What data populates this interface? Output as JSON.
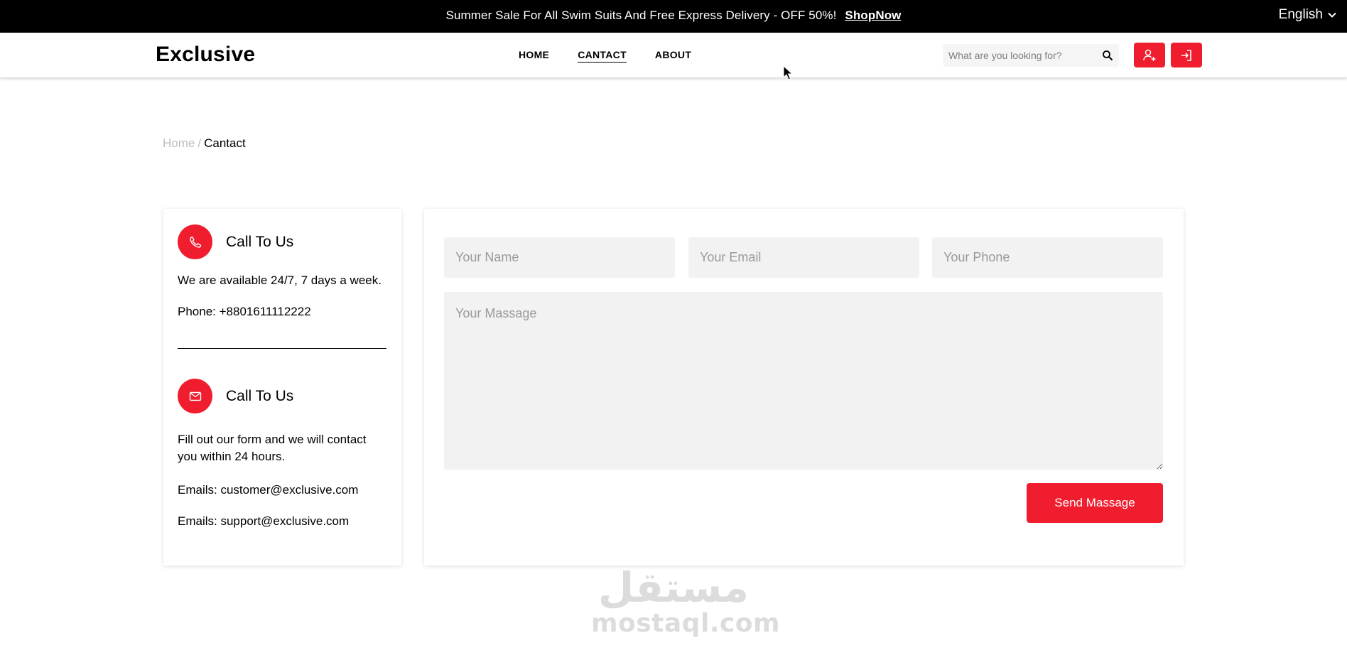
{
  "topbar": {
    "promo_text": "Summer Sale For All Swim Suits And Free Express Delivery - OFF 50%!",
    "promo_link": "ShopNow",
    "language": "English"
  },
  "header": {
    "logo": "Exclusive",
    "nav": [
      {
        "label": "HOME"
      },
      {
        "label": "CANTACT"
      },
      {
        "label": "ABOUT"
      }
    ],
    "search_placeholder": "What are you looking for?"
  },
  "breadcrumb": {
    "home": "Home",
    "separator": "/",
    "current": "Cantact"
  },
  "info": {
    "call": {
      "title": "Call To Us",
      "text": "We are available 24/7, 7 days a week.",
      "phone": "Phone: +8801611112222"
    },
    "write": {
      "title": "Call To Us",
      "text": "Fill out our form and we will contact you within 24 hours.",
      "email1": "Emails: customer@exclusive.com",
      "email2": "Emails: support@exclusive.com"
    }
  },
  "form": {
    "name_placeholder": "Your Name",
    "email_placeholder": "Your Email",
    "phone_placeholder": "Your Phone",
    "message_placeholder": "Your Massage",
    "submit_label": "Send Massage"
  },
  "watermark": {
    "arabic": "مستقل",
    "latin": "mostaql.com"
  },
  "colors": {
    "accent": "#f01d2e",
    "topbar_bg": "#000000",
    "field_bg": "#f2f2f2"
  }
}
